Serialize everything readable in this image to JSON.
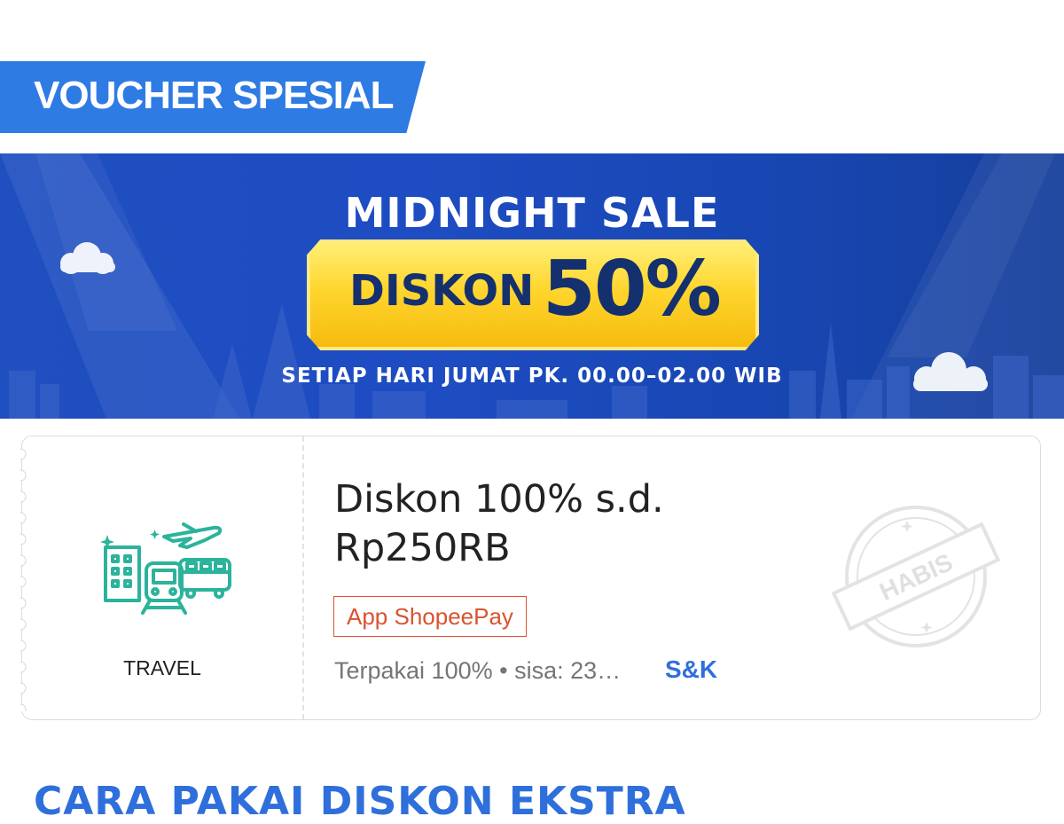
{
  "section": {
    "title": "VOUCHER SPESIAL"
  },
  "banner": {
    "headline": "MIDNIGHT SALE",
    "plate_word": "DISKON",
    "plate_value": "50%",
    "subline": "SETIAP HARI JUMAT PK. 00.00–02.00 WIB"
  },
  "voucher": {
    "category": "TRAVEL",
    "category_icon": "travel-icon",
    "title_line1": "Diskon 100% s.d.",
    "title_line2": "Rp250RB",
    "tag": "App ShopeePay",
    "usage": "Terpakai 100% • sisa: 23…",
    "terms_link": "S&K",
    "stamp_text": "HABIS"
  },
  "next_section": {
    "title": "CARA PAKAI DISKON EKSTRA"
  },
  "colors": {
    "brand_blue": "#2f7be4",
    "banner_blue": "#1e4cc2",
    "gold": "#ffd62e",
    "tag_red": "#d9532f",
    "icon_teal": "#2bb39b",
    "link_blue": "#2f6fdb"
  }
}
